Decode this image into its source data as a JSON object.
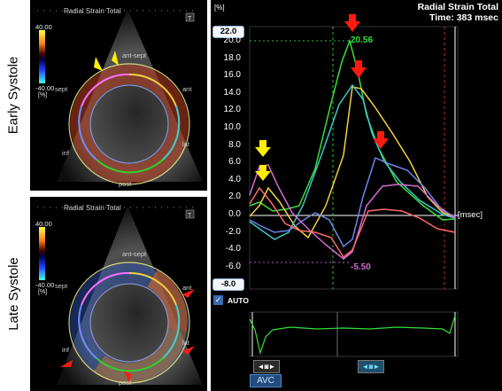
{
  "side_labels": {
    "top": "Early Systole",
    "bottom": "Late Systole"
  },
  "echo_panels": [
    {
      "title": "Radial Strain Total",
      "colorbar_max": "40.00",
      "colorbar_min": "-40.00",
      "colorbar_unit": "[%]",
      "segments": {
        "ant_sept": "ant-sept",
        "ant": "ant",
        "lat": "lat",
        "post": "post",
        "inf": "inf",
        "sept": "sept"
      },
      "icon": "T"
    },
    {
      "title": "Radial Strain Total",
      "colorbar_max": "40.00",
      "colorbar_min": "-40.00",
      "colorbar_unit": "[%]",
      "segments": {
        "ant_sept": "ant-sept",
        "ant": "ant",
        "lat": "lat",
        "post": "post",
        "inf": "inf",
        "sept": "sept"
      },
      "icon": "T"
    }
  ],
  "graph": {
    "header_title": "Radial Strain Total",
    "header_time": "Time: 383 msec",
    "unit": "[%]",
    "y_max_box": "22.0",
    "y_min_box": "-8.0",
    "ticks": [
      "20.0",
      "18.0",
      "16.0",
      "14.0",
      "12.0",
      "10.0",
      "8.0",
      "6.0",
      "4.0",
      "2.0",
      "0.0",
      "-2.0",
      "-4.0",
      "-6.0"
    ],
    "x_unit": "[msec]",
    "peak_max": "20.56",
    "peak_min": "-5.50",
    "auto_label": "AUTO",
    "avc_label": "AVC",
    "ctrl_icon": "◄◙►",
    "colors": {
      "green": "#35e03a",
      "yellow": "#f2d23a",
      "cyan": "#3fc7c9",
      "blue": "#6c86e8",
      "purple": "#d46ad4",
      "red": "#ff6a6a",
      "pink": "#e56aa8"
    }
  }
}
